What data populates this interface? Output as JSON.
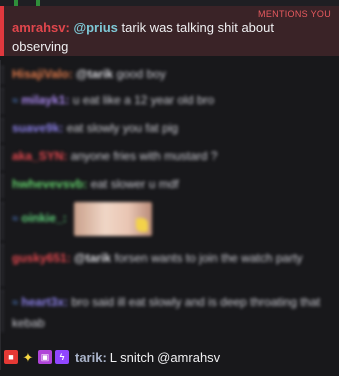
{
  "highlight": {
    "tag": "MENTIONS YOU",
    "username": "amrahsv:",
    "mention": "@prius",
    "message": " tarik was talking shit about observing"
  },
  "messages": [
    {
      "username": "HisajiValo:",
      "color": "#e07a4a",
      "mention": "@tarik",
      "text": " good boy"
    },
    {
      "username": "milayk1:",
      "color": "#a987ee",
      "text": " u eat like a 12 year old bro"
    },
    {
      "username": "suave9k:",
      "color": "#8a7fe6",
      "text": " eat slowly you fat pig"
    },
    {
      "username": "aka_SYN:",
      "color": "#e2474e",
      "text": " anyone fries with mustard ?"
    },
    {
      "username": "hwhevevsvb:",
      "color": "#62d06b",
      "text": " eat slower u mdf"
    },
    {
      "username": "oinkie_:",
      "color": "#5fcf7a",
      "text": "",
      "emote": "emote-image"
    },
    {
      "username": "gusky651:",
      "color": "#e2474e",
      "mention": "@tarik",
      "text": " forsen wants to join the watch party"
    },
    {
      "username": "heart3x:",
      "color": "#8a7fe6",
      "text": " bro said ill eat slowly and is deep throating that kebab"
    }
  ],
  "last_message": {
    "username": "tarik:",
    "text": " L snitch ",
    "mention": "@amrahsv",
    "badges": [
      "camera-badge",
      "star-badge",
      "gift-badge",
      "purple-badge"
    ]
  },
  "colors": {
    "background": "#18181b",
    "highlight_bg": "#3a2327",
    "highlight_border": "#e0383e"
  }
}
